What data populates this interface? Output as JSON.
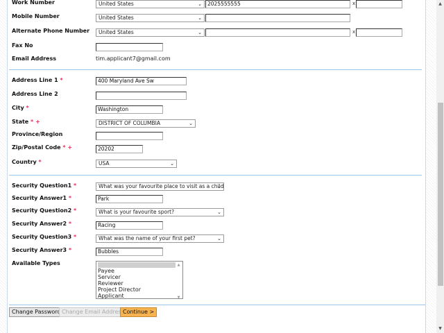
{
  "contact": {
    "work_label": "Work Number",
    "work_country": "United States",
    "work_number": "2025555555",
    "work_ext": "",
    "mobile_label": "Mobile Number",
    "mobile_country": "United States",
    "mobile_number": "",
    "alt_label": "Alternate Phone Number",
    "alt_country": "United States",
    "alt_number": "",
    "alt_ext": "",
    "ext_sep": "x",
    "fax_label": "Fax No",
    "fax_value": "",
    "email_label": "Email Address",
    "email_value": "tim.applicant7@gmail.com"
  },
  "address": {
    "line1_label": "Address Line 1",
    "line1_value": "400 Maryland Ave Sw",
    "line2_label": "Address Line 2",
    "line2_value": "",
    "city_label": "City",
    "city_value": "Washington",
    "state_label": "State",
    "state_value": "DISTRICT OF COLUMBIA",
    "province_label": "Province/Region",
    "province_value": "",
    "zip_label": "Zip/Postal Code",
    "zip_value": "20202",
    "country_label": "Country",
    "country_value": "USA",
    "required_mark": "*",
    "conditional_mark": "+"
  },
  "security": {
    "q1_label": "Security Question1",
    "q1_value": "What was your favourite place to visit as a child?",
    "a1_label": "Security Answer1",
    "a1_value": "Park",
    "q2_label": "Security Question2",
    "q2_value": "What is your favourite sport?",
    "a2_label": "Security Answer2",
    "a2_value": "Racing",
    "q3_label": "Security Question3",
    "q3_value": "What was the name of your first pet?",
    "a3_label": "Security Answer3",
    "a3_value": "Bubbles",
    "types_label": "Available Types",
    "types": [
      "Payee",
      "Servicer",
      "Reviewer",
      "Project Director",
      "Applicant"
    ]
  },
  "buttons": {
    "change_password": "Change Password",
    "change_email": "Change Email Address",
    "continue": "Continue >"
  },
  "icons": {
    "chevron": "chevron-down-icon"
  }
}
